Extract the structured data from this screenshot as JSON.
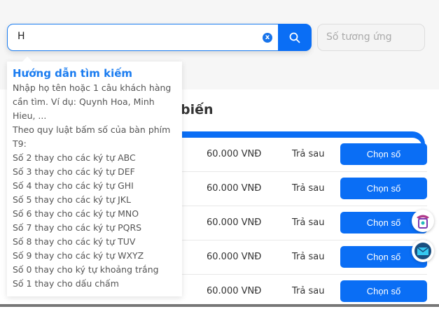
{
  "search": {
    "value": "H",
    "clear_label": "x"
  },
  "number_input": {
    "placeholder": "Số tương ứng"
  },
  "section_title": "biến",
  "rows": [
    {
      "price": "60.000 VNĐ",
      "type": "Trả sau",
      "button": "Chọn số"
    },
    {
      "price": "60.000 VNĐ",
      "type": "Trả sau",
      "button": "Chọn số"
    },
    {
      "price": "60.000 VNĐ",
      "type": "Trả sau",
      "button": "Chọn số"
    },
    {
      "price": "60.000 VNĐ",
      "type": "Trả sau",
      "button": "Chọn số"
    },
    {
      "price": "60.000 VNĐ",
      "type": "Trả sau",
      "button": "Chọn số"
    }
  ],
  "tooltip": {
    "title": "Hướng dẫn tìm kiếm",
    "lines": [
      "Nhập họ tên hoặc 1 câu khách hàng cần tìm. Ví dụ: Quynh Hoa, Minh Hieu, ...",
      "Theo quy luật bấm số của bàn phím T9:",
      "Số 2 thay cho các ký tự ABC",
      "Số 3 thay cho các ký tự DEF",
      "Số 4 thay cho các ký tự GHI",
      "Số 5 thay cho các ký tự JKL",
      "Số 6 thay cho các ký tự MNO",
      "Số 7 thay cho các ký tự PQRS",
      "Số 8 thay cho các ký tự TUV",
      "Số 9 thay cho các ký tự WXYZ",
      "Số 0 thay cho ký tự khoảng trắng",
      "Số 1 thay cho dấu chấm"
    ]
  },
  "colors": {
    "accent": "#0a6ef5"
  },
  "icons": {
    "search": "search-icon",
    "phone": "phone-icon",
    "mail": "mail-icon"
  }
}
